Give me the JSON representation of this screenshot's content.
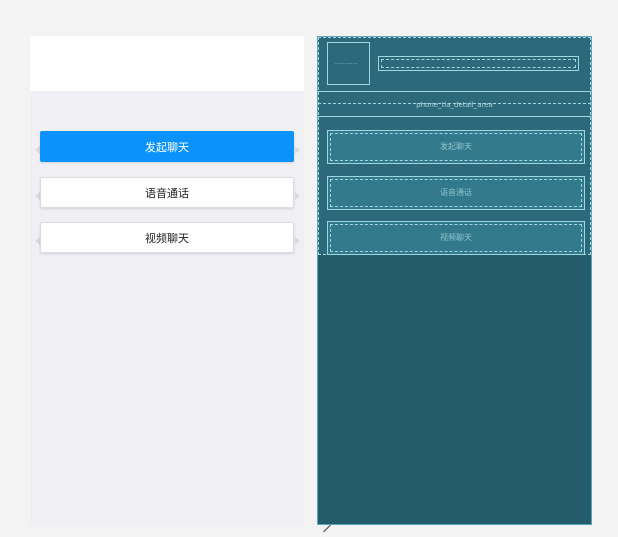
{
  "preview": {
    "buttons": [
      {
        "label": "发起聊天",
        "primary": true
      },
      {
        "label": "语音通话",
        "primary": false
      },
      {
        "label": "视频聊天",
        "primary": false
      }
    ]
  },
  "blueprint": {
    "avatar_placeholder": "··············",
    "bar_label": "phone_tia_detail_area",
    "buttons": [
      {
        "label": "发起聊天"
      },
      {
        "label": "语音通话"
      },
      {
        "label": "视频聊天"
      }
    ]
  },
  "colors": {
    "primary": "#0b93fb",
    "blueprint_bg": "#255c6c",
    "blueprint_line": "#9fd6e0"
  }
}
